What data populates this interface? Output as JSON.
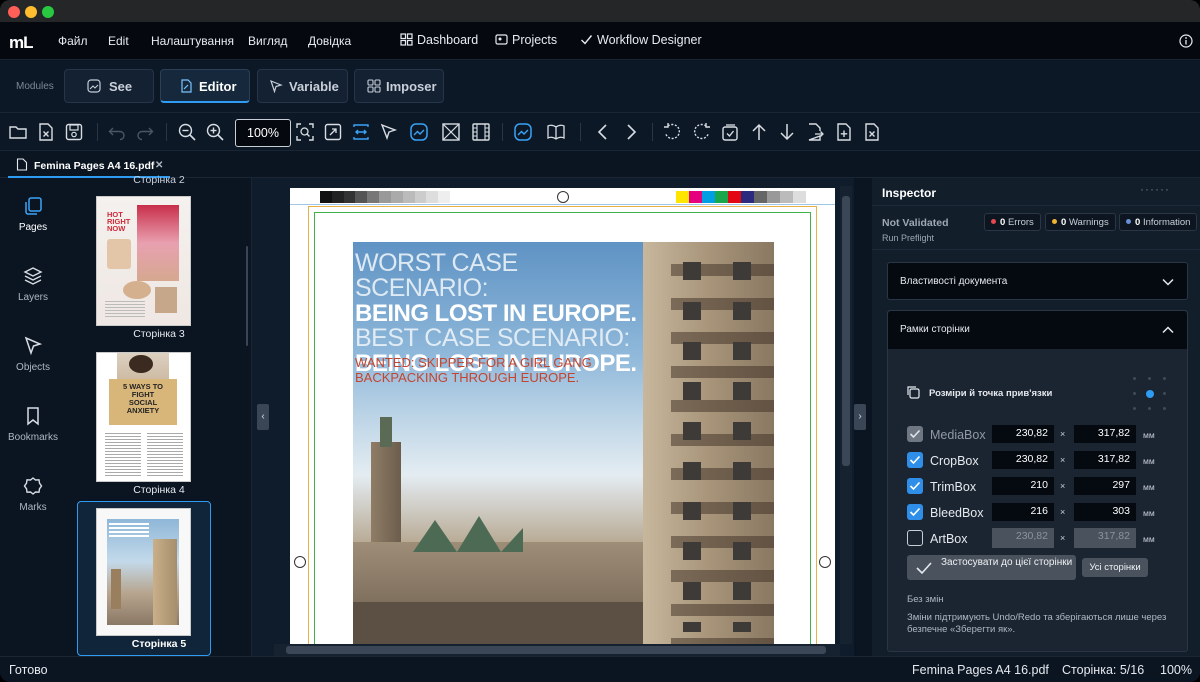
{
  "menu": {
    "items": [
      "Файл",
      "Edit",
      "Налаштування",
      "Вигляд",
      "Довідка"
    ]
  },
  "nav": {
    "dashboard": "Dashboard",
    "projects": "Projects",
    "workflow": "Workflow Designer"
  },
  "modules": {
    "label": "Modules",
    "items": [
      "See",
      "Editor",
      "Variable",
      "Imposer"
    ],
    "active": "Editor"
  },
  "toolbar": {
    "zoom": "100%"
  },
  "tab": {
    "title": "Femina Pages A4 16.pdf"
  },
  "sidebar": {
    "items": [
      "Pages",
      "Layers",
      "Objects",
      "Bookmarks",
      "Marks"
    ]
  },
  "thumbnails": {
    "top_partial": "Сторінка 2",
    "items": [
      "Сторінка 3",
      "Сторінка 4",
      "Сторінка 5"
    ],
    "selected": "Сторінка 5",
    "t3": {
      "title": "HOT RIGHT NOW"
    },
    "t4": {
      "title": "5 WAYS TO FIGHT SOCIAL ANXIETY"
    }
  },
  "page": {
    "line1": "WORST CASE SCENARIO:",
    "line2": "BEING LOST IN EUROPE.",
    "line3": "BEST CASE SCENARIO:",
    "line4": "BEING LOST IN EUROPE.",
    "line5": "WANTED: SKIPPER FOR A GIRL GANG",
    "line6": "BACKPACKING THROUGH EUROPE."
  },
  "inspector": {
    "title": "Inspector",
    "status": "Not Validated",
    "run": "Run Preflight",
    "errors": {
      "count": "0",
      "label": "Errors",
      "color": "#e5484d"
    },
    "warnings": {
      "count": "0",
      "label": "Warnings",
      "color": "#f2b233"
    },
    "info": {
      "count": "0",
      "label": "Information",
      "color": "#6b8fd6"
    },
    "doc_props": "Властивості документа",
    "page_boxes": "Рамки сторінки",
    "size_anchor": "Розміри й точка прив'язки",
    "boxes": [
      {
        "name": "MediaBox",
        "w": "230,82",
        "h": "317,82",
        "unit": "мм",
        "checked": "true",
        "enabled": "false"
      },
      {
        "name": "CropBox",
        "w": "230,82",
        "h": "317,82",
        "unit": "мм",
        "checked": "true",
        "enabled": "true"
      },
      {
        "name": "TrimBox",
        "w": "210",
        "h": "297",
        "unit": "мм",
        "checked": "true",
        "enabled": "true"
      },
      {
        "name": "BleedBox",
        "w": "216",
        "h": "303",
        "unit": "мм",
        "checked": "true",
        "enabled": "true"
      },
      {
        "name": "ArtBox",
        "w": "230,82",
        "h": "317,82",
        "unit": "мм",
        "checked": "false",
        "enabled": "false"
      }
    ],
    "times": "×",
    "apply": "Застосувати до цієї сторінки",
    "all_pages": "Усі сторінки",
    "no_changes": "Без змін",
    "note": "Зміни підтримують Undo/Redo та зберігаються лише через безпечне «Зберегти як»."
  },
  "status": {
    "left": "Готово",
    "file": "Femina Pages A4 16.pdf",
    "page": "Сторінка: 5/16",
    "zoom": "100%"
  }
}
